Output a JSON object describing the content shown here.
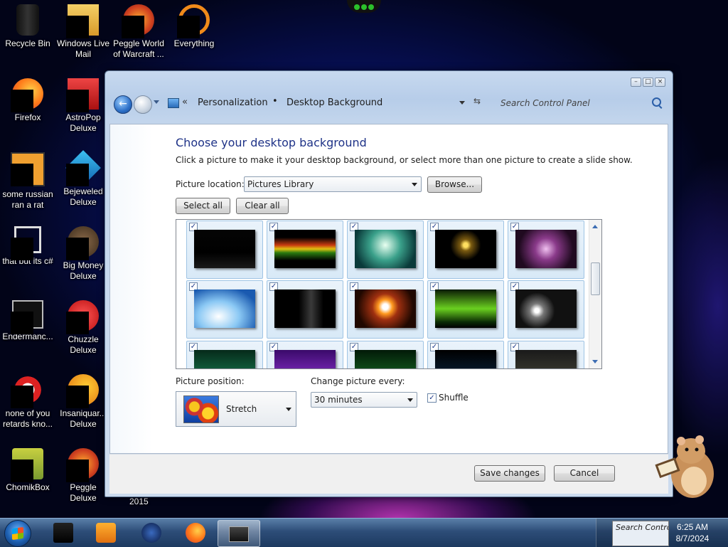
{
  "desktop": {
    "icons": [
      {
        "label": "Recycle Bin"
      },
      {
        "label": "Windows Live Mail"
      },
      {
        "label": "Peggle World of Warcraft ..."
      },
      {
        "label": "Everything"
      },
      {
        "label": "Firefox"
      },
      {
        "label": "AstroPop Deluxe"
      },
      {
        "label": "some russian ran a rat"
      },
      {
        "label": "Bejeweled Deluxe"
      },
      {
        "label": "that but its c#"
      },
      {
        "label": "Big Money Deluxe"
      },
      {
        "label": "Endermanc..."
      },
      {
        "label": "Chuzzle Deluxe"
      },
      {
        "label": "none of you retards kno..."
      },
      {
        "label": "Insaniquar... Deluxe"
      },
      {
        "label": "ChomikBox"
      },
      {
        "label": "Peggle Deluxe"
      }
    ],
    "year_text": "2015"
  },
  "window": {
    "breadcrumb": [
      "Personalization",
      "Desktop Background"
    ],
    "search_placeholder": "Search Control Panel",
    "heading": "Choose your desktop background",
    "description": "Click a picture to make it your desktop background, or select more than one picture to create a slide show.",
    "picture_location_label": "Picture location:",
    "picture_location_value": "Pictures Library",
    "browse_label": "Browse...",
    "select_all_label": "Select all",
    "clear_all_label": "Clear all",
    "picture_position_label": "Picture position:",
    "picture_position_value": "Stretch",
    "change_every_label": "Change picture every:",
    "change_every_value": "30 minutes",
    "shuffle_label": "Shuffle",
    "save_label": "Save changes",
    "cancel_label": "Cancel"
  },
  "thumbnails_checked": true,
  "taskbar": {
    "search_text": "Search Control",
    "time": "6:25 AM",
    "date": "8/7/2024"
  },
  "colors": {
    "heading": "#1e3287",
    "accent": "#2c6fc7"
  }
}
